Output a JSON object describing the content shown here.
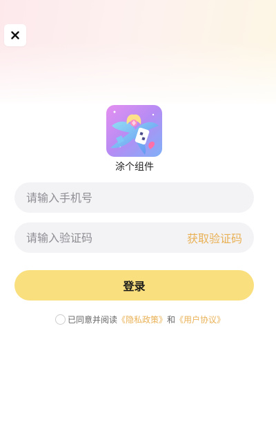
{
  "header": {
    "close_icon": "close-icon"
  },
  "app": {
    "name": "涂个组件",
    "icon": "app-logo-icon"
  },
  "phone": {
    "placeholder": "请输入手机号",
    "value": ""
  },
  "code": {
    "placeholder": "请输入验证码",
    "value": "",
    "get_code_label": "获取验证码"
  },
  "login": {
    "label": "登录"
  },
  "agreement": {
    "prefix": "已同意并阅读",
    "privacy": "《隐私政策》",
    "conjunction": "和",
    "terms": "《用户协议》",
    "checked": false
  },
  "colors": {
    "accent": "#e9b155",
    "button": "#f9df7d",
    "field_bg": "#f3f3f6"
  }
}
